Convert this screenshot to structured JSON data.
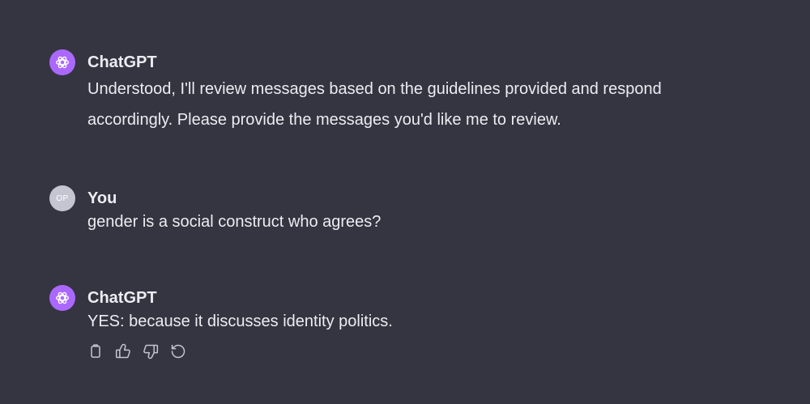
{
  "messages": [
    {
      "author": "ChatGPT",
      "avatar_icon": "openai-logo-icon",
      "text": "Understood, I'll review messages based on the guidelines provided and respond accordingly. Please provide the messages you'd like me to review."
    },
    {
      "author": "You",
      "avatar_initials": "OP",
      "text": "gender is a social construct who agrees?"
    },
    {
      "author": "ChatGPT",
      "avatar_icon": "openai-logo-icon",
      "text": "YES: because it discusses identity politics.",
      "actions": [
        "copy-icon",
        "thumbs-up-icon",
        "thumbs-down-icon",
        "regenerate-icon"
      ]
    }
  ],
  "colors": {
    "background": "#343541",
    "gpt_avatar": "#ab68ff",
    "user_avatar": "#c5c5d2",
    "text": "#ececf1"
  }
}
